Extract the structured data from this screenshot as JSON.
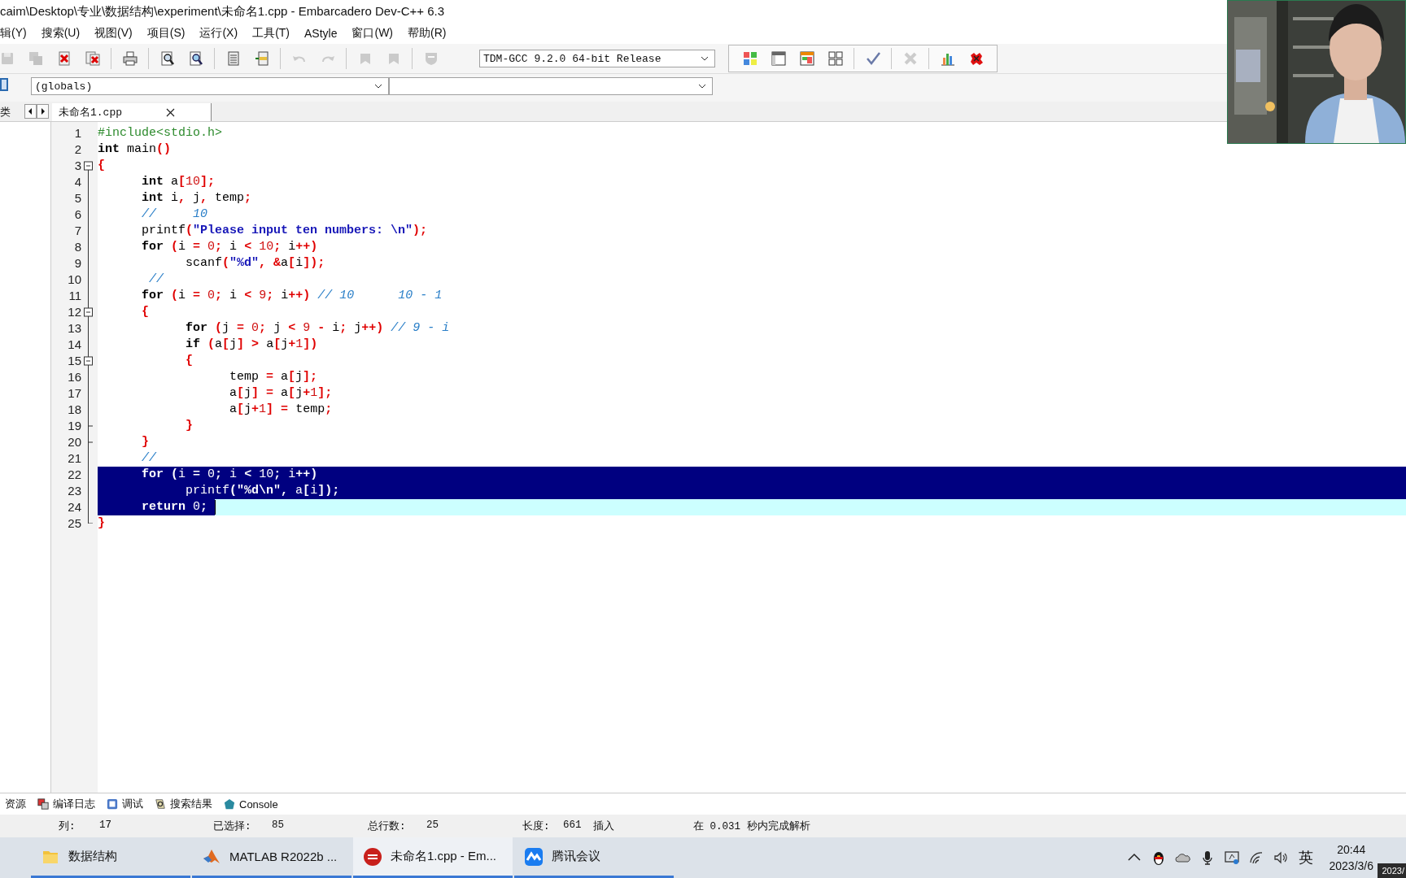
{
  "window": {
    "title": "caim\\Desktop\\专业\\数据结构\\experiment\\未命名1.cpp - Embarcadero Dev-C++ 6.3"
  },
  "menu": [
    "辑(Y)",
    "搜索(U)",
    "视图(V)",
    "项目(S)",
    "运行(X)",
    "工具(T)",
    "AStyle",
    "窗口(W)",
    "帮助(R)"
  ],
  "toolbar_left": [
    {
      "kind": "save",
      "disabled": true
    },
    {
      "kind": "save-all",
      "disabled": true
    },
    {
      "kind": "close-file",
      "disabled": false
    },
    {
      "kind": "close-all",
      "disabled": false
    },
    {
      "kind": "sep"
    },
    {
      "kind": "print",
      "disabled": false
    },
    {
      "kind": "sep"
    },
    {
      "kind": "find",
      "disabled": false
    },
    {
      "kind": "replace",
      "disabled": false
    },
    {
      "kind": "sep"
    },
    {
      "kind": "list",
      "disabled": false
    },
    {
      "kind": "insert",
      "disabled": false
    },
    {
      "kind": "sep"
    },
    {
      "kind": "undo",
      "disabled": true
    },
    {
      "kind": "redo",
      "disabled": true
    },
    {
      "kind": "sep"
    },
    {
      "kind": "bookmark",
      "disabled": true
    },
    {
      "kind": "bookmark",
      "disabled": true
    },
    {
      "kind": "sep"
    },
    {
      "kind": "shield",
      "disabled": true
    }
  ],
  "compiler_select": {
    "value": "TDM-GCC 9.2.0 64-bit Release"
  },
  "toolbar_right": [
    {
      "kind": "grid-color",
      "disabled": false
    },
    {
      "kind": "window",
      "disabled": false
    },
    {
      "kind": "window-color",
      "disabled": false
    },
    {
      "kind": "grid",
      "disabled": false
    },
    {
      "kind": "sep"
    },
    {
      "kind": "check",
      "disabled": false
    },
    {
      "kind": "sep"
    },
    {
      "kind": "cross",
      "disabled": true
    },
    {
      "kind": "sep"
    },
    {
      "kind": "chart",
      "disabled": false
    },
    {
      "kind": "stop",
      "disabled": false
    }
  ],
  "scope_select": {
    "value": "(globals)"
  },
  "side_tab": "类",
  "file_tab": {
    "label": "未命名1.cpp",
    "selected": true
  },
  "code": {
    "lines": [
      {
        "number": "1",
        "kind": "plain",
        "selected": false,
        "current": false,
        "tokens": [
          {
            "kind": "pre",
            "text": "#include<stdio.h>"
          }
        ]
      },
      {
        "number": "2",
        "kind": "plain",
        "selected": false,
        "current": false,
        "tokens": [
          {
            "kind": "kw",
            "text": "int"
          },
          {
            "kind": "id",
            "text": " main"
          },
          {
            "kind": "sym",
            "text": "()"
          }
        ]
      },
      {
        "number": "3",
        "kind": "fold-open",
        "selected": false,
        "current": false,
        "tokens": [
          {
            "kind": "sym",
            "text": "{"
          }
        ]
      },
      {
        "number": "4",
        "kind": "fold-body",
        "selected": false,
        "current": false,
        "tokens": [
          {
            "kind": "kw",
            "text": "\tint"
          },
          {
            "kind": "id",
            "text": " a"
          },
          {
            "kind": "sym",
            "text": "["
          },
          {
            "kind": "num",
            "text": "10"
          },
          {
            "kind": "sym",
            "text": "];"
          }
        ]
      },
      {
        "number": "5",
        "kind": "fold-body",
        "selected": false,
        "current": false,
        "tokens": [
          {
            "kind": "kw",
            "text": "\tint"
          },
          {
            "kind": "id",
            "text": " i"
          },
          {
            "kind": "sym",
            "text": ","
          },
          {
            "kind": "id",
            "text": " j"
          },
          {
            "kind": "sym",
            "text": ","
          },
          {
            "kind": "id",
            "text": " temp"
          },
          {
            "kind": "sym",
            "text": ";"
          }
        ]
      },
      {
        "number": "6",
        "kind": "fold-body",
        "selected": false,
        "current": false,
        "tokens": [
          {
            "kind": "cmt",
            "text": "\t//     10"
          }
        ]
      },
      {
        "number": "7",
        "kind": "fold-body",
        "selected": false,
        "current": false,
        "tokens": [
          {
            "kind": "id",
            "text": "\tprintf"
          },
          {
            "kind": "sym",
            "text": "("
          },
          {
            "kind": "str",
            "text": "\"Please input ten numbers: \\n\""
          },
          {
            "kind": "sym",
            "text": ");"
          }
        ]
      },
      {
        "number": "8",
        "kind": "fold-body",
        "selected": false,
        "current": false,
        "tokens": [
          {
            "kind": "kw",
            "text": "\tfor "
          },
          {
            "kind": "sym",
            "text": "("
          },
          {
            "kind": "id",
            "text": "i "
          },
          {
            "kind": "sym",
            "text": "="
          },
          {
            "kind": "num",
            "text": " 0"
          },
          {
            "kind": "sym",
            "text": ";"
          },
          {
            "kind": "id",
            "text": " i "
          },
          {
            "kind": "sym",
            "text": "<"
          },
          {
            "kind": "num",
            "text": " 10"
          },
          {
            "kind": "sym",
            "text": ";"
          },
          {
            "kind": "id",
            "text": " i"
          },
          {
            "kind": "sym",
            "text": "++)"
          }
        ]
      },
      {
        "number": "9",
        "kind": "fold-body",
        "selected": false,
        "current": false,
        "tokens": [
          {
            "kind": "id",
            "text": "\t\tscanf"
          },
          {
            "kind": "sym",
            "text": "("
          },
          {
            "kind": "str",
            "text": "\"%d\""
          },
          {
            "kind": "sym",
            "text": ", &"
          },
          {
            "kind": "id",
            "text": "a"
          },
          {
            "kind": "sym",
            "text": "["
          },
          {
            "kind": "id",
            "text": "i"
          },
          {
            "kind": "sym",
            "text": "]);"
          }
        ]
      },
      {
        "number": "10",
        "kind": "fold-body",
        "selected": false,
        "current": false,
        "tokens": [
          {
            "kind": "cmt",
            "text": "\t //"
          }
        ]
      },
      {
        "number": "11",
        "kind": "fold-body",
        "selected": false,
        "current": false,
        "tokens": [
          {
            "kind": "kw",
            "text": "\tfor "
          },
          {
            "kind": "sym",
            "text": "("
          },
          {
            "kind": "id",
            "text": "i "
          },
          {
            "kind": "sym",
            "text": "="
          },
          {
            "kind": "num",
            "text": " 0"
          },
          {
            "kind": "sym",
            "text": ";"
          },
          {
            "kind": "id",
            "text": " i "
          },
          {
            "kind": "sym",
            "text": "<"
          },
          {
            "kind": "num",
            "text": " 9"
          },
          {
            "kind": "sym",
            "text": ";"
          },
          {
            "kind": "id",
            "text": " i"
          },
          {
            "kind": "sym",
            "text": "++) "
          },
          {
            "kind": "cmt",
            "text": "// 10      10 - 1"
          }
        ]
      },
      {
        "number": "12",
        "kind": "fold-open",
        "selected": false,
        "current": false,
        "tokens": [
          {
            "kind": "sym",
            "text": "\t{"
          }
        ]
      },
      {
        "number": "13",
        "kind": "fold-body",
        "selected": false,
        "current": false,
        "tokens": [
          {
            "kind": "kw",
            "text": "\t\tfor "
          },
          {
            "kind": "sym",
            "text": "("
          },
          {
            "kind": "id",
            "text": "j "
          },
          {
            "kind": "sym",
            "text": "="
          },
          {
            "kind": "num",
            "text": " 0"
          },
          {
            "kind": "sym",
            "text": ";"
          },
          {
            "kind": "id",
            "text": " j "
          },
          {
            "kind": "sym",
            "text": "<"
          },
          {
            "kind": "num",
            "text": " 9 "
          },
          {
            "kind": "sym",
            "text": "-"
          },
          {
            "kind": "id",
            "text": " i"
          },
          {
            "kind": "sym",
            "text": ";"
          },
          {
            "kind": "id",
            "text": " j"
          },
          {
            "kind": "sym",
            "text": "++) "
          },
          {
            "kind": "cmt",
            "text": "// 9 - i"
          }
        ]
      },
      {
        "number": "14",
        "kind": "fold-body",
        "selected": false,
        "current": false,
        "tokens": [
          {
            "kind": "kw",
            "text": "\t\tif "
          },
          {
            "kind": "sym",
            "text": "("
          },
          {
            "kind": "id",
            "text": "a"
          },
          {
            "kind": "sym",
            "text": "["
          },
          {
            "kind": "id",
            "text": "j"
          },
          {
            "kind": "sym",
            "text": "] >"
          },
          {
            "kind": "id",
            "text": " a"
          },
          {
            "kind": "sym",
            "text": "["
          },
          {
            "kind": "id",
            "text": "j"
          },
          {
            "kind": "sym",
            "text": "+"
          },
          {
            "kind": "num",
            "text": "1"
          },
          {
            "kind": "sym",
            "text": "])"
          }
        ]
      },
      {
        "number": "15",
        "kind": "fold-open",
        "selected": false,
        "current": false,
        "tokens": [
          {
            "kind": "sym",
            "text": "\t\t{"
          }
        ]
      },
      {
        "number": "16",
        "kind": "fold-body",
        "selected": false,
        "current": false,
        "tokens": [
          {
            "kind": "id",
            "text": "\t\t\ttemp "
          },
          {
            "kind": "sym",
            "text": "="
          },
          {
            "kind": "id",
            "text": " a"
          },
          {
            "kind": "sym",
            "text": "["
          },
          {
            "kind": "id",
            "text": "j"
          },
          {
            "kind": "sym",
            "text": "];"
          }
        ]
      },
      {
        "number": "17",
        "kind": "fold-body",
        "selected": false,
        "current": false,
        "tokens": [
          {
            "kind": "id",
            "text": "\t\t\ta"
          },
          {
            "kind": "sym",
            "text": "["
          },
          {
            "kind": "id",
            "text": "j"
          },
          {
            "kind": "sym",
            "text": "] ="
          },
          {
            "kind": "id",
            "text": " a"
          },
          {
            "kind": "sym",
            "text": "["
          },
          {
            "kind": "id",
            "text": "j"
          },
          {
            "kind": "sym",
            "text": "+"
          },
          {
            "kind": "num",
            "text": "1"
          },
          {
            "kind": "sym",
            "text": "];"
          }
        ]
      },
      {
        "number": "18",
        "kind": "fold-body",
        "selected": false,
        "current": false,
        "tokens": [
          {
            "kind": "id",
            "text": "\t\t\ta"
          },
          {
            "kind": "sym",
            "text": "["
          },
          {
            "kind": "id",
            "text": "j"
          },
          {
            "kind": "sym",
            "text": "+"
          },
          {
            "kind": "num",
            "text": "1"
          },
          {
            "kind": "sym",
            "text": "] ="
          },
          {
            "kind": "id",
            "text": " temp"
          },
          {
            "kind": "sym",
            "text": ";"
          }
        ]
      },
      {
        "number": "19",
        "kind": "fold-end",
        "selected": false,
        "current": false,
        "tokens": [
          {
            "kind": "sym",
            "text": "\t\t}"
          }
        ]
      },
      {
        "number": "20",
        "kind": "fold-end",
        "selected": false,
        "current": false,
        "tokens": [
          {
            "kind": "sym",
            "text": "\t}"
          }
        ]
      },
      {
        "number": "21",
        "kind": "fold-body",
        "selected": false,
        "current": false,
        "tokens": [
          {
            "kind": "cmt",
            "text": "\t//"
          }
        ]
      },
      {
        "number": "22",
        "kind": "fold-body",
        "selected": true,
        "current": false,
        "tokens": [
          {
            "kind": "kw",
            "text": "\tfor "
          },
          {
            "kind": "sym",
            "text": "("
          },
          {
            "kind": "id",
            "text": "i "
          },
          {
            "kind": "sym",
            "text": "="
          },
          {
            "kind": "num",
            "text": " 0"
          },
          {
            "kind": "sym",
            "text": ";"
          },
          {
            "kind": "id",
            "text": " i "
          },
          {
            "kind": "sym",
            "text": "<"
          },
          {
            "kind": "num",
            "text": " 10"
          },
          {
            "kind": "sym",
            "text": ";"
          },
          {
            "kind": "id",
            "text": " i"
          },
          {
            "kind": "sym",
            "text": "++)"
          }
        ]
      },
      {
        "number": "23",
        "kind": "fold-body",
        "selected": true,
        "current": false,
        "tokens": [
          {
            "kind": "id",
            "text": "\t\tprintf"
          },
          {
            "kind": "sym",
            "text": "("
          },
          {
            "kind": "str",
            "text": "\"%d\\n\""
          },
          {
            "kind": "sym",
            "text": ","
          },
          {
            "kind": "id",
            "text": " a"
          },
          {
            "kind": "sym",
            "text": "["
          },
          {
            "kind": "id",
            "text": "i"
          },
          {
            "kind": "sym",
            "text": "]);"
          }
        ]
      },
      {
        "number": "24",
        "kind": "fold-body",
        "selected": true,
        "current": true,
        "tokens": [
          {
            "kind": "kw",
            "text": "\treturn "
          },
          {
            "kind": "num",
            "text": "0"
          },
          {
            "kind": "sym",
            "text": "; "
          }
        ]
      },
      {
        "number": "25",
        "kind": "fold-close",
        "selected": false,
        "current": false,
        "tokens": [
          {
            "kind": "sym",
            "text": "}"
          }
        ]
      }
    ]
  },
  "bottom_tabs": [
    {
      "kind": "none",
      "label": "资源"
    },
    {
      "kind": "log",
      "label": "编译日志"
    },
    {
      "kind": "debug",
      "label": "调试"
    },
    {
      "kind": "search",
      "label": "搜索结果"
    },
    {
      "kind": "console",
      "label": "Console"
    }
  ],
  "status_bar": {
    "fields": [
      {
        "label": "列:",
        "value": "17"
      },
      {
        "label": "已选择:",
        "value": "85"
      },
      {
        "label": "总行数:",
        "value": "25"
      },
      {
        "label": "长度:",
        "value": "661"
      }
    ],
    "mode": "插入",
    "parse_info": "在 0.031 秒内完成解析"
  },
  "taskbar": {
    "apps": [
      {
        "kind": "folder",
        "label": "数据结构",
        "selected": false
      },
      {
        "kind": "matlab",
        "label": "MATLAB R2022b ...",
        "selected": false
      },
      {
        "kind": "devcpp",
        "label": "未命名1.cpp - Em...",
        "selected": true
      },
      {
        "kind": "meeting",
        "label": "腾讯会议",
        "selected": false
      }
    ],
    "tray": [
      {
        "kind": "chevron"
      },
      {
        "kind": "penguin"
      },
      {
        "kind": "cloud"
      },
      {
        "kind": "mic"
      },
      {
        "kind": "display"
      },
      {
        "kind": "wifi"
      },
      {
        "kind": "speaker"
      }
    ],
    "ime": "英",
    "time": "20:44",
    "date": "2023/3/6",
    "tooltip": "2023/"
  },
  "webcam": {
    "kind": "picture"
  }
}
